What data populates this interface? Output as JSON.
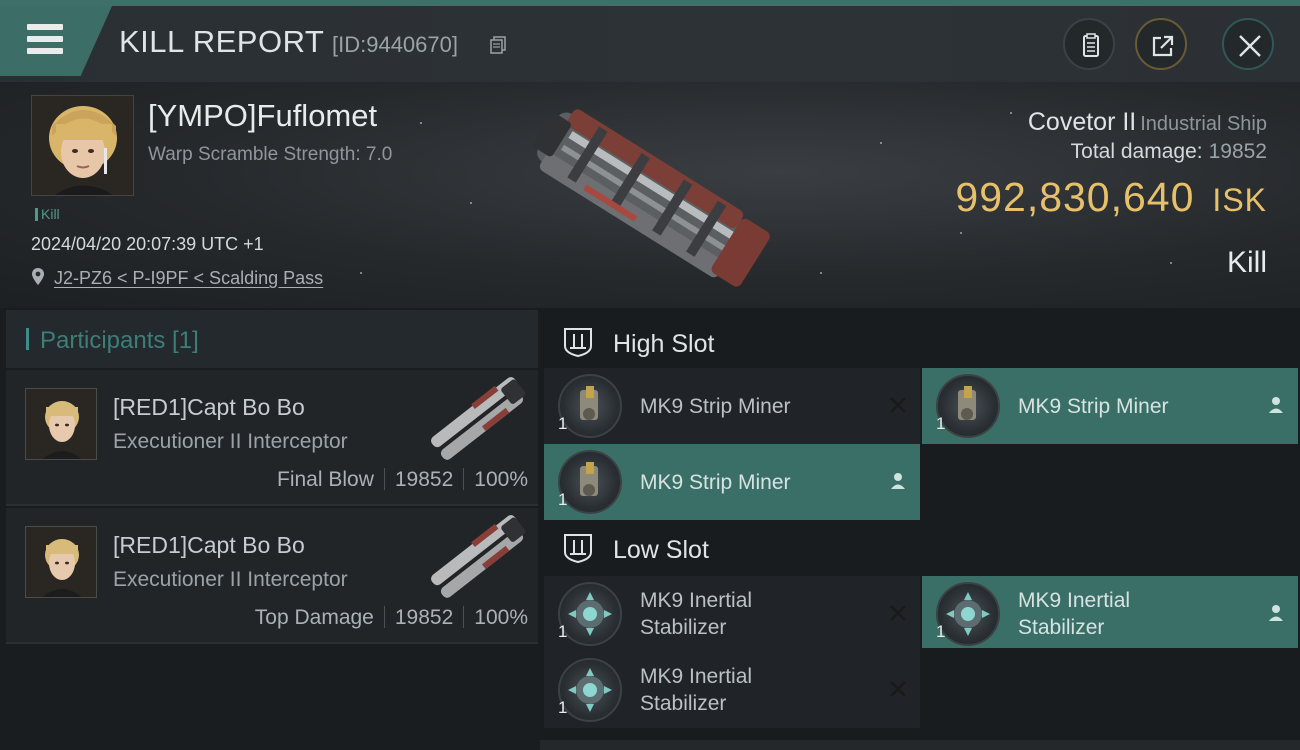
{
  "header": {
    "title": "KILL REPORT",
    "id_label": "[ID:9440670]"
  },
  "victim": {
    "name": "[YMPO]Fuflomet",
    "warp_scramble": "Warp Scramble Strength: 7.0",
    "kill_tag": "Kill",
    "datetime": "2024/04/20 20:07:39 UTC +1",
    "location": "J2-PZ6 < P-I9PF < Scalding Pass",
    "ship_name": "Covetor II",
    "ship_class": "Industrial Ship",
    "total_damage_label": "Total damage:",
    "total_damage_value": "19852",
    "isk_value": "992,830,640",
    "isk_unit": "ISK",
    "result": "Kill"
  },
  "participants": {
    "label": "Participants [1]",
    "rows": [
      {
        "name": "[RED1]Capt Bo Bo",
        "ship": "Executioner II Interceptor",
        "role": "Final Blow",
        "damage": "19852",
        "percent": "100%"
      },
      {
        "name": "[RED1]Capt Bo Bo",
        "ship": "Executioner II Interceptor",
        "role": "Top Damage",
        "damage": "19852",
        "percent": "100%"
      }
    ]
  },
  "slots": {
    "high": {
      "label": "High Slot",
      "modules": [
        {
          "name": "MK9 Strip Miner",
          "qty": "1",
          "state": "destroyed"
        },
        {
          "name": "MK9 Strip Miner",
          "qty": "1",
          "state": "dropped"
        },
        {
          "name": "MK9 Strip Miner",
          "qty": "1",
          "state": "dropped"
        }
      ]
    },
    "low": {
      "label": "Low Slot",
      "modules": [
        {
          "name": "MK9 Inertial Stabilizer",
          "qty": "1",
          "state": "destroyed"
        },
        {
          "name": "MK9 Inertial Stabilizer",
          "qty": "1",
          "state": "dropped"
        },
        {
          "name": "MK9 Inertial Stabilizer",
          "qty": "1",
          "state": "destroyed"
        }
      ]
    }
  },
  "icons": {
    "menu": "menu-icon",
    "copy": "copy-icon",
    "notes": "notes-icon",
    "share": "share-icon",
    "close": "close-icon",
    "location": "location-pin-icon",
    "slot": "slot-icon",
    "destroyed": "x-icon",
    "dropped": "person-icon"
  },
  "colors": {
    "accent": "#3a6f68",
    "isk": "#e7c16a",
    "participants_label": "#3e7e78"
  }
}
